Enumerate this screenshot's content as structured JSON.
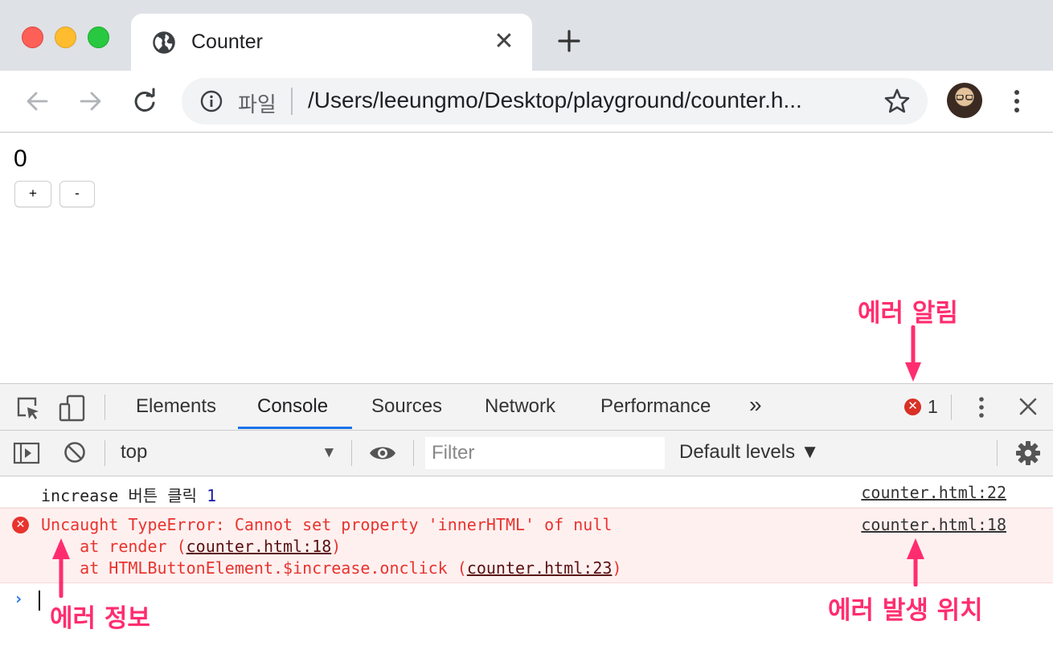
{
  "window": {
    "traffic_lights": [
      "close",
      "minimize",
      "maximize"
    ]
  },
  "tab": {
    "title": "Counter",
    "icon": "globe-icon",
    "close_glyph": "✕"
  },
  "toolbar": {
    "scheme_label": "파일",
    "url": "/Users/leeungmo/Desktop/playground/counter.h..."
  },
  "page": {
    "counter_value": "0",
    "plus_label": "+",
    "minus_label": "-"
  },
  "devtools": {
    "tabs": [
      "Elements",
      "Console",
      "Sources",
      "Network",
      "Performance"
    ],
    "more_tabs": "»",
    "active_tab": "Console",
    "error_count": "1",
    "error_badge": "✕",
    "context": "top",
    "context_arrow": "▼",
    "filter_placeholder": "Filter",
    "levels": "Default levels ▼"
  },
  "console": {
    "log": {
      "text": "increase 버튼 클릭 ",
      "value": "1",
      "source": "counter.html:22"
    },
    "error": {
      "icon_glyph": "✕",
      "message": "Uncaught TypeError: Cannot set property 'innerHTML' of null",
      "source": "counter.html:18",
      "stack1_prefix": "    at render (",
      "stack1_link": "counter.html:18",
      "stack1_suffix": ")",
      "stack2_prefix": "    at HTMLButtonElement.$increase.onclick (",
      "stack2_link": "counter.html:23",
      "stack2_suffix": ")"
    },
    "prompt": "›"
  },
  "annotations": {
    "error_alert": "에러 알림",
    "error_info": "에러 정보",
    "error_location": "에러 발생 위치",
    "color": "#ff2d6f"
  }
}
